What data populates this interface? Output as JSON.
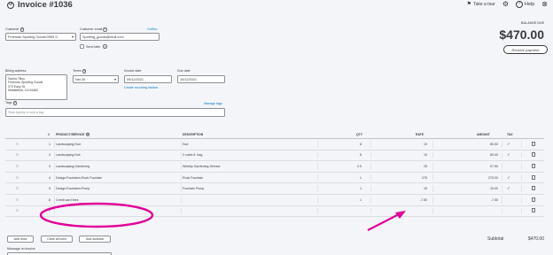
{
  "header": {
    "title": "Invoice #1036",
    "take_tour": "Take a tour",
    "help": "Help"
  },
  "customer": {
    "label": "Customer",
    "value": "Freeman Sporting Goods:0969 O"
  },
  "email": {
    "label": "Customer email",
    "value": "Sporting_goods@intuit.com",
    "cc_bcc": "Cc/Bcc",
    "send_later": "Send later"
  },
  "balance": {
    "label": "BALANCE DUE",
    "amount": "$470.00",
    "receive_payment": "Receive payment"
  },
  "billing": {
    "label": "Billing address",
    "lines": [
      "Sasha Tillou",
      "Freeman Sporting Goods",
      "370 Easy St.",
      "Middlefield, CA 94482"
    ]
  },
  "terms": {
    "label": "Terms",
    "value": "Net 30"
  },
  "invoice_date": {
    "label": "Invoice date",
    "value": "09/12/2021",
    "recurring_link": "Create recurring invoice"
  },
  "due_date": {
    "label": "Due date",
    "value": "10/12/2021"
  },
  "tags": {
    "label": "Tags",
    "manage": "Manage tags",
    "placeholder": "Start typing to add a tag"
  },
  "table": {
    "headers": {
      "num": "#",
      "product": "PRODUCT/SERVICE",
      "description": "DESCRIPTION",
      "qty": "QTY",
      "rate": "RATE",
      "amount": "AMOUNT",
      "tax": "TAX"
    },
    "rows": [
      {
        "num": "1",
        "product": "Landscaping:Sod",
        "description": "Sod",
        "qty": "8",
        "rate": "10",
        "amount": "80.00",
        "tax": "✓"
      },
      {
        "num": "2",
        "product": "Landscaping:Soil",
        "description": "2 cubic ft. bag",
        "qty": "8",
        "rate": "10",
        "amount": "80.00",
        "tax": "✓"
      },
      {
        "num": "3",
        "product": "Landscaping:Gardening",
        "description": "Weekly Gardening Service",
        "qty": "2.5",
        "rate": "25",
        "amount": "07.50",
        "tax": ""
      },
      {
        "num": "4",
        "product": "Design:Fountains:Rock Fountain",
        "description": "Rock Fountain",
        "qty": "1",
        "rate": "275",
        "amount": "275.00",
        "tax": "✓"
      },
      {
        "num": "5",
        "product": "Design:Fountains:Pump",
        "description": "Fountain Pump",
        "qty": "1",
        "rate": "15",
        "amount": "15.00",
        "tax": "✓"
      },
      {
        "num": "6",
        "product": "Credit card fees",
        "description": "",
        "qty": "1",
        "rate": "-7.50",
        "amount": "-7.50",
        "tax": ""
      },
      {
        "num": "7",
        "product": "",
        "description": "",
        "qty": "",
        "rate": "",
        "amount": "",
        "tax": ""
      }
    ]
  },
  "actions": {
    "add_lines": "Add lines",
    "clear_lines": "Clear all lines",
    "add_subtotal": "Add subtotal"
  },
  "subtotal": {
    "label": "Subtotal",
    "value": "$470.00"
  },
  "message": {
    "label": "Message on invoice"
  },
  "colors": {
    "accent": "#0077c5",
    "annotation": "#e10098"
  }
}
